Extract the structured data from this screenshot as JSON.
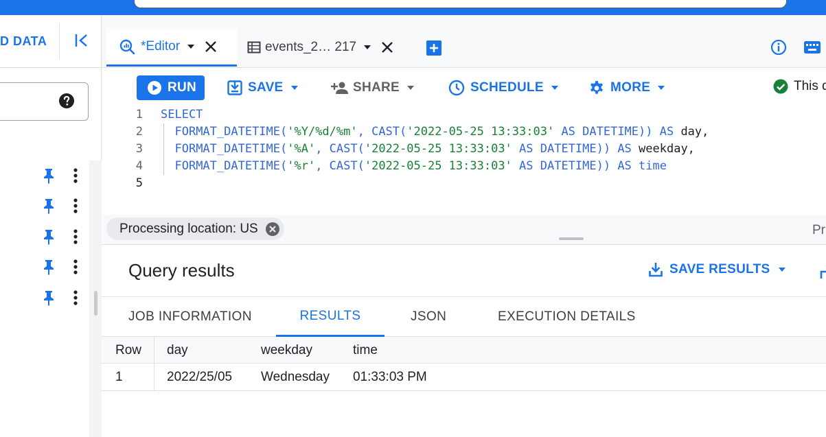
{
  "left_panel": {
    "title": "D DATA",
    "rows": 5
  },
  "tabs": [
    {
      "label": "*Editor"
    },
    {
      "label": "events_2… 217"
    }
  ],
  "toolbar": {
    "run": "RUN",
    "save": "SAVE",
    "share": "SHARE",
    "schedule": "SCHEDULE",
    "more": "MORE",
    "status": "This q"
  },
  "editor": {
    "line_numbers": [
      "1",
      "2",
      "3",
      "4",
      "5"
    ],
    "lines": [
      [
        [
          "kw",
          "SELECT"
        ]
      ],
      [
        [
          "plain",
          "  "
        ],
        [
          "kw",
          "FORMAT_DATETIME("
        ],
        [
          "str",
          "'%Y/%d/%m'"
        ],
        [
          "kw",
          ", CAST("
        ],
        [
          "str",
          "'2022-05-25 13:33:03'"
        ],
        [
          "kw",
          " AS DATETIME)) AS "
        ],
        [
          "plain",
          "day,"
        ]
      ],
      [
        [
          "plain",
          "  "
        ],
        [
          "kw",
          "FORMAT_DATETIME("
        ],
        [
          "str",
          "'%A'"
        ],
        [
          "kw",
          ", CAST("
        ],
        [
          "str",
          "'2022-05-25 13:33:03'"
        ],
        [
          "kw",
          " AS DATETIME)) AS "
        ],
        [
          "plain",
          "weekday,"
        ]
      ],
      [
        [
          "plain",
          "  "
        ],
        [
          "kw",
          "FORMAT_DATETIME("
        ],
        [
          "str",
          "'%r'"
        ],
        [
          "kw",
          ", CAST("
        ],
        [
          "str",
          "'2022-05-25 13:33:03'"
        ],
        [
          "kw",
          " AS DATETIME)) AS time"
        ]
      ],
      [
        [
          "plain",
          ""
        ]
      ]
    ]
  },
  "processing": {
    "chip": "Processing location: US",
    "right": "Pr"
  },
  "results": {
    "title": "Query results",
    "save_results": "SAVE RESULTS",
    "tabs": [
      "JOB INFORMATION",
      "RESULTS",
      "JSON",
      "EXECUTION DETAILS"
    ],
    "active_tab": "RESULTS",
    "columns": [
      "Row",
      "day",
      "weekday",
      "time"
    ],
    "rows": [
      [
        "1",
        "2022/25/05",
        "Wednesday",
        "01:33:03 PM"
      ]
    ]
  },
  "colors": {
    "accent": "#1a73e8",
    "keyword": "#3367d6",
    "string": "#188038",
    "success": "#188038"
  },
  "icons": [
    "collapse-left-icon",
    "help-icon",
    "pin-icon",
    "more-vert-icon",
    "query-icon",
    "table-icon",
    "add-tab-icon",
    "info-icon",
    "keyboard-icon",
    "play-icon",
    "save-icon",
    "share-person-icon",
    "schedule-clock-icon",
    "gear-icon",
    "check-circle-icon",
    "close-circle-icon",
    "download-icon"
  ]
}
